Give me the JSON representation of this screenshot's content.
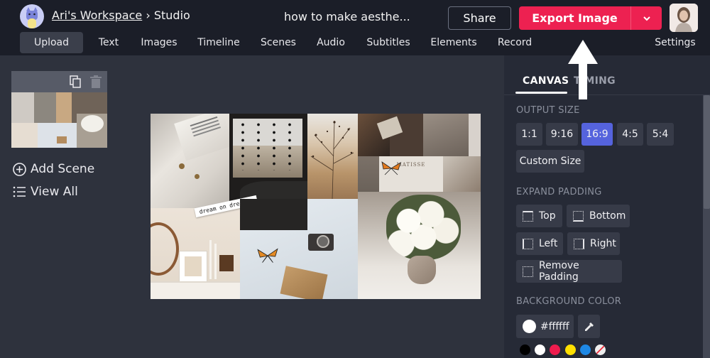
{
  "header": {
    "workspace": "Ari's Workspace",
    "separator": "›",
    "section": "Studio",
    "project_title": "how to make aesthe...",
    "share_label": "Share",
    "export_label": "Export Image",
    "workspace_avatar_icon": "cat-avatar-icon",
    "user_avatar_icon": "user-avatar-photo"
  },
  "nav": {
    "items": [
      {
        "label": "Upload",
        "active": true
      },
      {
        "label": "Text"
      },
      {
        "label": "Images"
      },
      {
        "label": "Timeline"
      },
      {
        "label": "Scenes"
      },
      {
        "label": "Audio"
      },
      {
        "label": "Subtitles"
      },
      {
        "label": "Elements"
      },
      {
        "label": "Record"
      }
    ],
    "settings_label": "Settings"
  },
  "scenes": {
    "add_scene_label": "Add Scene",
    "view_all_label": "View All"
  },
  "canvas": {
    "sticker_text": "dream on dreamer",
    "poster_text": "MATISSE"
  },
  "panel": {
    "tabs": [
      {
        "label": "CANVAS",
        "active": true
      },
      {
        "label": "TIMING"
      }
    ],
    "output_size": {
      "label": "OUTPUT SIZE",
      "options": [
        "1:1",
        "9:16",
        "16:9",
        "4:5",
        "5:4"
      ],
      "selected": "16:9",
      "custom_label": "Custom Size"
    },
    "expand_padding": {
      "label": "EXPAND PADDING",
      "top": "Top",
      "bottom": "Bottom",
      "left": "Left",
      "right": "Right",
      "remove": "Remove Padding"
    },
    "background_color": {
      "label": "BACKGROUND COLOR",
      "value": "#ffffff",
      "swatches": [
        "#000000",
        "#ffffff",
        "#ee1c4e",
        "#ffe000",
        "#1e88e5",
        "none"
      ]
    }
  },
  "colors": {
    "accent": "#ed2151",
    "selected": "#5563dd"
  }
}
